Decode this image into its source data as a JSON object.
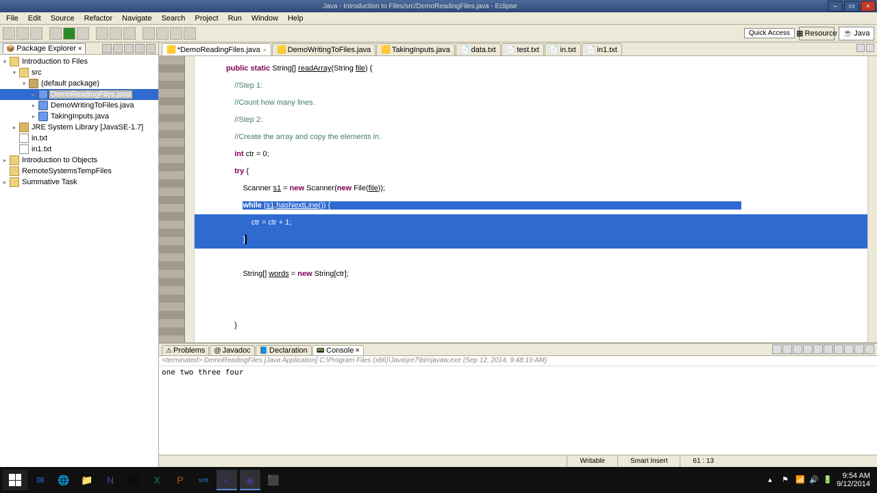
{
  "window": {
    "title": "Java - Introduction to Files/src/DemoReadingFiles.java - Eclipse"
  },
  "window_controls": {
    "min": "–",
    "max": "▭",
    "close": "×"
  },
  "menubar": [
    "File",
    "Edit",
    "Source",
    "Refactor",
    "Navigate",
    "Search",
    "Project",
    "Run",
    "Window",
    "Help"
  ],
  "quick_access": "Quick Access",
  "perspectives": {
    "resource": "Resource",
    "java": "Java"
  },
  "package_explorer": {
    "title": "Package Explorer"
  },
  "tree": {
    "p0": {
      "name": "Introduction to Files"
    },
    "src": "src",
    "pkg": "(default package)",
    "f0": "DemoReadingFiles.java",
    "f1": "DemoWritingToFiles.java",
    "f2": "TakingInputs.java",
    "lib": "JRE System Library [JavaSE-1.7]",
    "t0": "in.txt",
    "t1": "in1.txt",
    "p1": "Introduction to Objects",
    "p2": "RemoteSystemsTempFiles",
    "p3": "Summative Task"
  },
  "editor_tabs": [
    {
      "label": "*DemoReadingFiles.java",
      "active": true,
      "dirty": true
    },
    {
      "label": "DemoWritingToFiles.java"
    },
    {
      "label": "TakingInputs.java"
    },
    {
      "label": "data.txt"
    },
    {
      "label": "test.txt"
    },
    {
      "label": "in.txt"
    },
    {
      "label": "in1.txt"
    }
  ],
  "code": {
    "l0a": "public",
    "l0b": " ",
    "l0c": "static",
    "l0d": " String[] ",
    "l0e": "readArray",
    "l0f": "(String ",
    "l0g": "file",
    "l0h": ") {",
    "l1": "//Step 1:",
    "l2": "//Count how many lines.",
    "l3": "//Step 2:",
    "l4": "//Create the array and copy the elements in.",
    "l5a": "int",
    "l5b": " ctr = 0;",
    "l6a": "try",
    "l6b": " {",
    "l7a": "Scanner ",
    "l7b": "s1",
    "l7c": " = ",
    "l7d": "new",
    "l7e": " Scanner(",
    "l7f": "new",
    "l7g": " File(",
    "l7h": "file",
    "l7i": "));",
    "l8a": "while",
    "l8b": " (",
    "l8c": "s1",
    "l8d": ".",
    "l8e": "hasNextLine",
    "l8f": "()) {",
    "l9": "ctr = ctr + 1;",
    "l10": "}",
    "l11a": "String[] ",
    "l11b": "words",
    "l11c": " = ",
    "l11d": "new",
    "l11e": " String[ctr];",
    "l12": "}"
  },
  "bottom_tabs": [
    "Problems",
    "Javadoc",
    "Declaration",
    "Console"
  ],
  "console": {
    "info": "<terminated> DemoReadingFiles [Java Application] C:\\Program Files (x86)\\Java\\jre7\\bin\\javaw.exe (Sep 12, 2014, 9:48:19 AM)",
    "out": "one two three four"
  },
  "status": {
    "writable": "Writable",
    "insert": "Smart Insert",
    "pos": "61 : 13"
  },
  "taskbar": {
    "time": "9:54 AM",
    "date": "9/12/2014"
  }
}
